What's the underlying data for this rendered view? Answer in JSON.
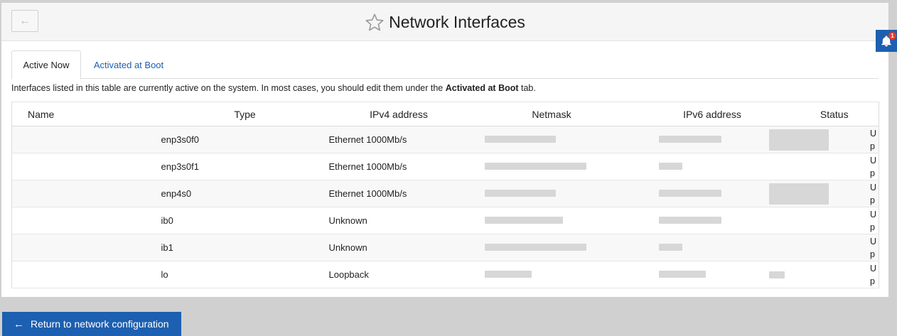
{
  "header": {
    "title": "Network Interfaces",
    "back_icon": "arrow-left-icon",
    "star_icon": "star-outline-icon"
  },
  "notifications": {
    "icon": "bell-icon",
    "count": "1"
  },
  "tabs": [
    {
      "label": "Active Now",
      "active": true
    },
    {
      "label": "Activated at Boot",
      "active": false
    }
  ],
  "description": {
    "before": "Interfaces listed in this table are currently active on the system. In most cases, you should edit them under the ",
    "bold": "Activated at Boot",
    "after": " tab."
  },
  "table": {
    "columns": [
      "Name",
      "Type",
      "IPv4 address",
      "Netmask",
      "IPv6 address",
      "Status"
    ],
    "rows": [
      {
        "name": "enp3s0f0",
        "type": "Ethernet 1000Mb/s",
        "status": "Up"
      },
      {
        "name": "enp3s0f1",
        "type": "Ethernet 1000Mb/s",
        "status": "Up"
      },
      {
        "name": "enp4s0",
        "type": "Ethernet 1000Mb/s",
        "status": "Up"
      },
      {
        "name": "ib0",
        "type": "Unknown",
        "status": "Up"
      },
      {
        "name": "ib1",
        "type": "Unknown",
        "status": "Up"
      },
      {
        "name": "lo",
        "type": "Loopback",
        "status": "Up"
      }
    ]
  },
  "footer": {
    "return_label": "Return to network configuration",
    "return_icon": "arrow-left-icon"
  },
  "colors": {
    "accent": "#1d5fb0",
    "badge": "#e8392b"
  }
}
